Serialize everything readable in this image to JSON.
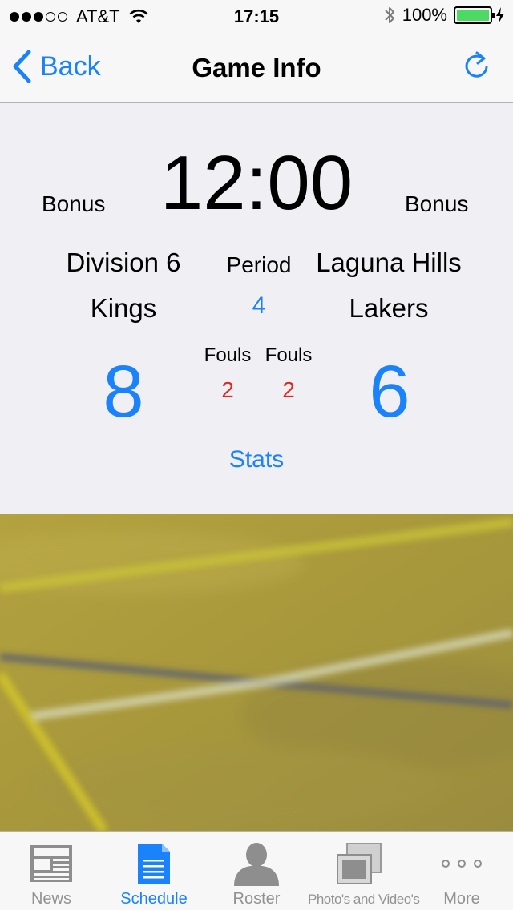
{
  "status_bar": {
    "carrier": "AT&T",
    "time": "17:15",
    "battery": "100%",
    "battery_level": 1.0,
    "signal_bars_filled": 3,
    "signal_bars_total": 5
  },
  "nav": {
    "back_label": "Back",
    "title": "Game Info"
  },
  "game": {
    "clock": "12:00",
    "left_bonus": "Bonus",
    "right_bonus": "Bonus",
    "home_team_line1": "Division 6",
    "home_team_line2": "Kings",
    "away_team_line1": "Laguna Hills",
    "away_team_line2": "Lakers",
    "period_label": "Period",
    "period_value": "4",
    "home_score": "8",
    "away_score": "6",
    "home_fouls_label": "Fouls",
    "away_fouls_label": "Fouls",
    "home_fouls": "2",
    "away_fouls": "2",
    "stats_label": "Stats"
  },
  "tabs": [
    {
      "label": "News",
      "icon": "newspaper-icon",
      "active": false
    },
    {
      "label": "Schedule",
      "icon": "document-icon",
      "active": true
    },
    {
      "label": "Roster",
      "icon": "person-icon",
      "active": false
    },
    {
      "label": "Photo's and Video's",
      "icon": "photos-icon",
      "active": false
    },
    {
      "label": "More",
      "icon": "more-dots-icon",
      "active": false
    }
  ],
  "colors": {
    "accent": "#1a82fb",
    "fouls": "#e0281e",
    "battery": "#4cd964",
    "background": "#f0eff4"
  }
}
